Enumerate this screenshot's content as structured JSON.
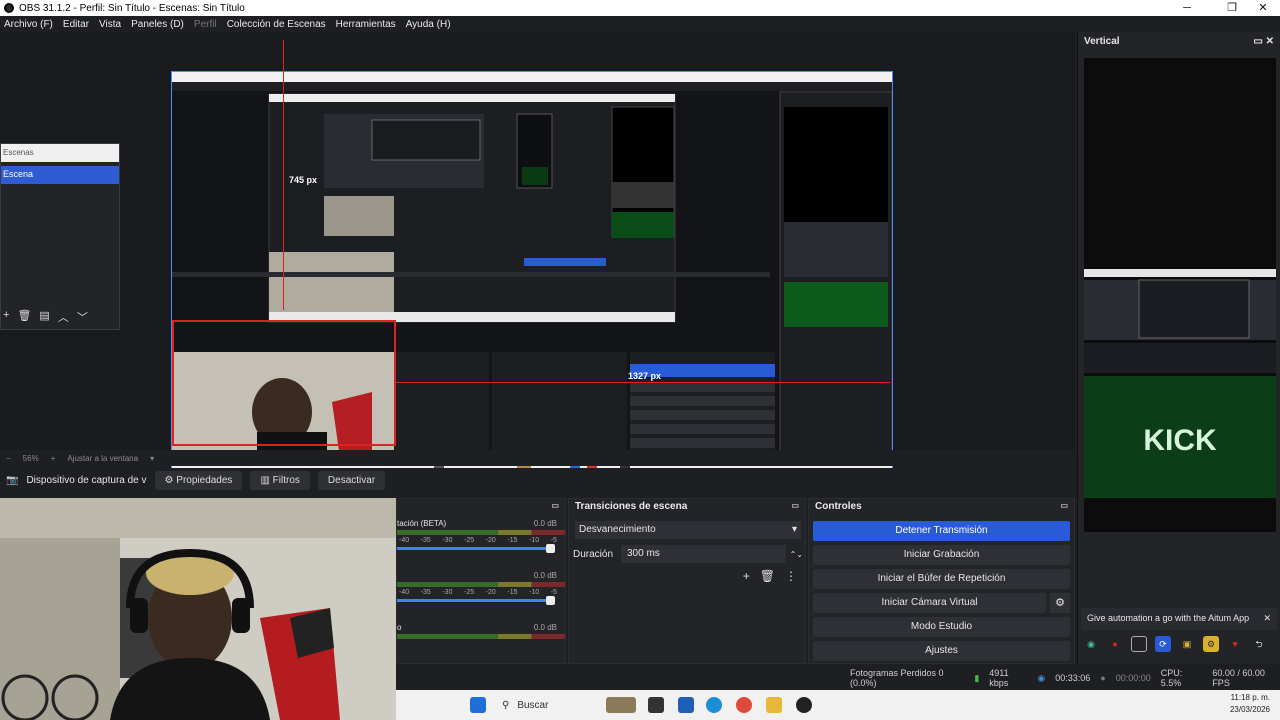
{
  "window": {
    "title": "OBS 31.1.2 - Perfil: Sin Título - Escenas: Sin Título",
    "minimize": "─",
    "maximize": "❐",
    "close": "✕"
  },
  "menu": {
    "archivo": "Archivo (F)",
    "editar": "Editar",
    "vista": "Vista",
    "paneles": "Paneles (D)",
    "perfil": "Perfil",
    "coleccion": "Colección de Escenas",
    "herramientas": "Herramientas",
    "ayuda": "Ayuda (H)"
  },
  "scenes": {
    "header": "Escenas",
    "selected": "Escena"
  },
  "vertical": {
    "title": "Vertical"
  },
  "measurements": {
    "vertical_px": "745 px",
    "horizontal_px": "1327 px"
  },
  "zoom": {
    "level": "56%",
    "fit": "Ajustar a la ventana"
  },
  "source_toolbar": {
    "source_name": "Dispositivo de captura de v",
    "properties": "Propiedades",
    "filters": "Filtros",
    "deactivate": "Desactivar"
  },
  "mixer": {
    "channel1_label": "tación (BETA)",
    "channel1_db": "0.0 dB",
    "channel2_db": "0.0 dB",
    "channel3_label": "o",
    "channel3_db": "0.0 dB",
    "ticks": [
      "-40",
      "-35",
      "-30",
      "-25",
      "-20",
      "-15",
      "-10",
      "-5"
    ]
  },
  "transitions": {
    "title": "Transiciones de escena",
    "selected": "Desvanecimiento",
    "duration_label": "Duración",
    "duration_value": "300 ms"
  },
  "controls": {
    "title": "Controles",
    "stop_stream": "Detener Transmisión",
    "start_recording": "Iniciar Grabación",
    "replay_buffer": "Iniciar el Búfer de Repetición",
    "virtual_cam": "Iniciar Cámara Virtual",
    "studio_mode": "Modo Estudio",
    "settings": "Ajustes"
  },
  "notification": {
    "text": "Give automation a go with the Aitum App"
  },
  "status": {
    "frames_dropped": "Fotogramas Perdidos 0 (0.0%)",
    "bitrate": "4911 kbps",
    "stream_time": "00:33:06",
    "rec_time": "00:00:00",
    "cpu": "CPU: 5.5%",
    "fps": "60.00 / 60.00 FPS"
  },
  "taskbar": {
    "search": "Buscar",
    "time": "11:18 p. m.",
    "date": "23/03/2026"
  },
  "colors": {
    "accent": "#2a5bd7",
    "selection_border": "#d22222",
    "background": "#1e1f22"
  }
}
